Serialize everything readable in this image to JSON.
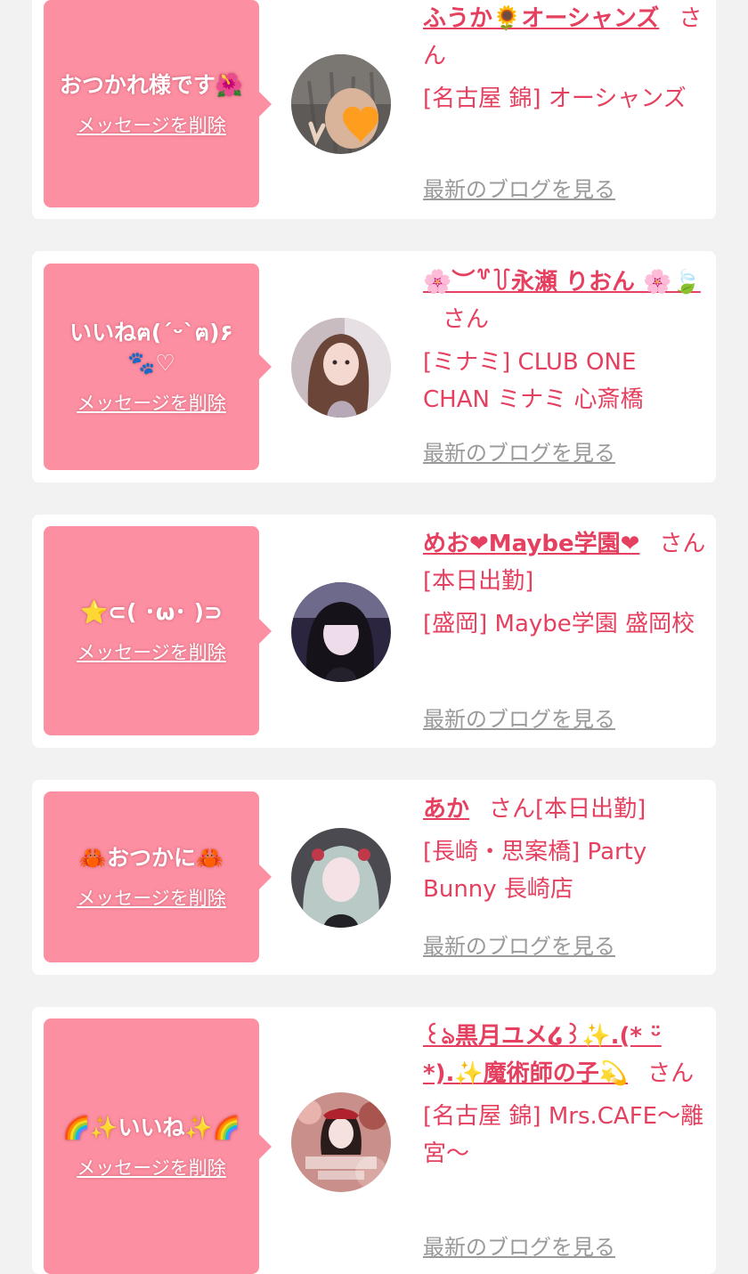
{
  "delete_label": "メッセージを削除",
  "blog_label": "最新のブログを見る",
  "colors": {
    "accent": "#e5405f",
    "bubble": "#fd8fa2",
    "link_gray": "#9a9a9a"
  },
  "cards": [
    {
      "message": "おつかれ様です🌺",
      "name": "ふうか🌻オーシャンズ",
      "suffix": "さん",
      "shop": "[名古屋 錦] オーシャンズ"
    },
    {
      "message": "いいねฅ(´ᵕ`ฅ)۶\n🐾♡",
      "name": "🌸︶꒷꒦永瀬 りおん 🌸🍃",
      "suffix": "さん",
      "shop": "[ミナミ] CLUB ONE CHAN ミナミ 心斎橋"
    },
    {
      "message": "⭐️⊂( ･ω･ )⊃",
      "name": "めお❤Maybe学園❤",
      "suffix": "さん[本日出勤]",
      "shop": "[盛岡] Maybe学園 盛岡校"
    },
    {
      "message": "🦀おつかに🦀",
      "name": "あか",
      "suffix": "さん[本日出勤]",
      "shop": "[長崎・思案橋] Party Bunny 長崎店"
    },
    {
      "message": "🌈✨いいね✨🌈",
      "name": "꒰ঌ黒月ユメ໒꒱✨.(* ᵕ̈ *).✨魔術師の子💫",
      "suffix": "さん",
      "shop": "[名古屋 錦] Mrs.CAFE〜離宮〜"
    }
  ]
}
